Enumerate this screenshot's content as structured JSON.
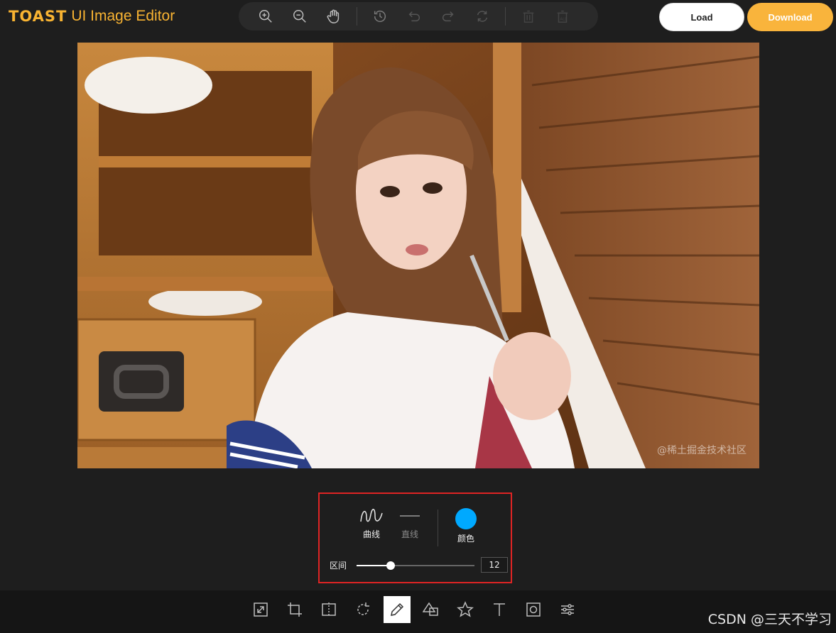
{
  "header": {
    "brand": "TOAST",
    "product": "UI Image Editor",
    "load_label": "Load",
    "download_label": "Download"
  },
  "toolbar": {
    "icons": [
      "zoom-in-icon",
      "zoom-out-icon",
      "hand-icon",
      "history-icon",
      "undo-icon",
      "redo-icon",
      "reset-icon",
      "delete-icon",
      "delete-all-icon"
    ]
  },
  "canvas": {
    "watermark": "@稀土掘金技术社区"
  },
  "draw_submenu": {
    "free_label": "曲线",
    "straight_label": "直线",
    "color_label": "颜色",
    "color": "#00a9ff",
    "range_label": "区间",
    "range_value": "12",
    "range_fraction": 0.29
  },
  "bottom_menu": {
    "items": [
      "resize-icon",
      "crop-icon",
      "flip-icon",
      "rotate-icon",
      "draw-icon",
      "shape-icon",
      "icon-icon",
      "text-icon",
      "mask-icon",
      "filter-icon"
    ],
    "active": "draw-icon"
  },
  "footer": {
    "watermark": "CSDN @三天不学习"
  },
  "colors": {
    "accent": "#f8b332",
    "selection": "#e02424",
    "background": "#1e1e1e"
  }
}
